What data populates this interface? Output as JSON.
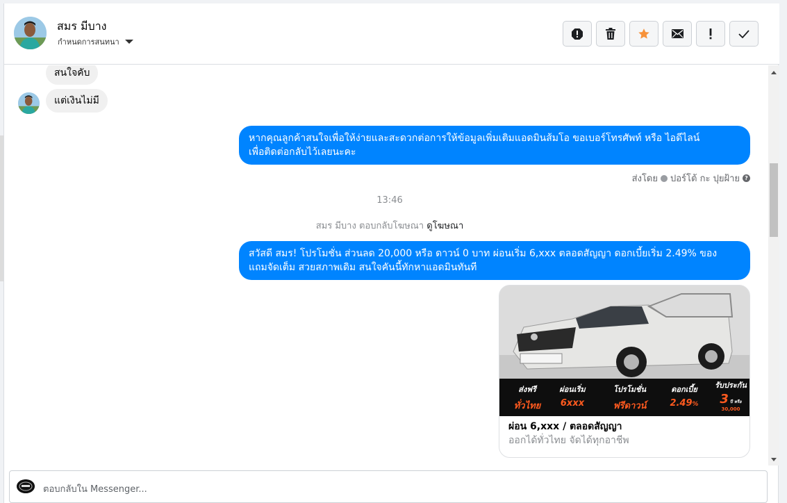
{
  "header": {
    "contact_name": "สมร มีบาง",
    "assign_label": "กำหนดการสนทนา",
    "toolbar_icons": [
      "report-icon",
      "trash-icon",
      "star-icon",
      "mail-icon",
      "exclamation-icon",
      "check-icon"
    ]
  },
  "messages": {
    "incoming_1": "สนใจคับ",
    "incoming_2": "แต่เงินไม่มี",
    "outgoing_1_line1": "หากคุณลูกค้าสนใจเพื่อให้ง่ายและสะดวกต่อการให้ข้อมูลเพิ่มเติมแอดมินส้มโอ ขอเบอร์โทรศัพท์ หรือ ไอดีไลน์",
    "outgoing_1_line2": "เพื่อติดต่อกลับไว้เลยนะคะ",
    "sent_by_label": "ส่งโดย",
    "sent_by_name": "ปอร์โต้ กะ ปุยฝ้าย",
    "timestamp": "13:46",
    "ad_reply_text": "สมร มีบาง ตอบกลับโฆษณา",
    "ad_reply_link": "ดูโฆษณา",
    "outgoing_2_line1": "สวัสดี สมร! โปรโมชั่น ส่วนลด 20,000 หรือ ดาวน์ 0 บาท ผ่อนเริ่ม 6,xxx ตลอดสัญญา ดอกเบี้ยเริ่ม 2.49% ของ",
    "outgoing_2_line2": "แถมจัดเต็ม สวยสภาพเดิม สนใจคันนี้ทักหาแอดมินทันที"
  },
  "ad_card": {
    "promo": [
      {
        "label": "ส่งฟรี",
        "value": "ทั่วไทย"
      },
      {
        "label": "ผ่อนเริ่ม",
        "value": "6xxx"
      },
      {
        "label": "โปรโมชั่น",
        "value": "ฟรีดาวน์"
      },
      {
        "label": "ดอกเบี้ย",
        "value": "2.49"
      },
      {
        "label": "รับประกัน",
        "value": "3"
      }
    ],
    "promo_value_suffix": "%",
    "promo_warranty_suffix": "ปี หรือ",
    "promo_warranty_km": "30,000",
    "title": "ผ่อน 6,xxx / ตลอดสัญญา",
    "subtitle": "ออกได้ทั่วไทย จัดได้ทุกอาชีพ"
  },
  "composer": {
    "placeholder": "ตอบกลับใน Messenger..."
  },
  "colors": {
    "accent": "#0084ff",
    "star": "#f7923a"
  }
}
